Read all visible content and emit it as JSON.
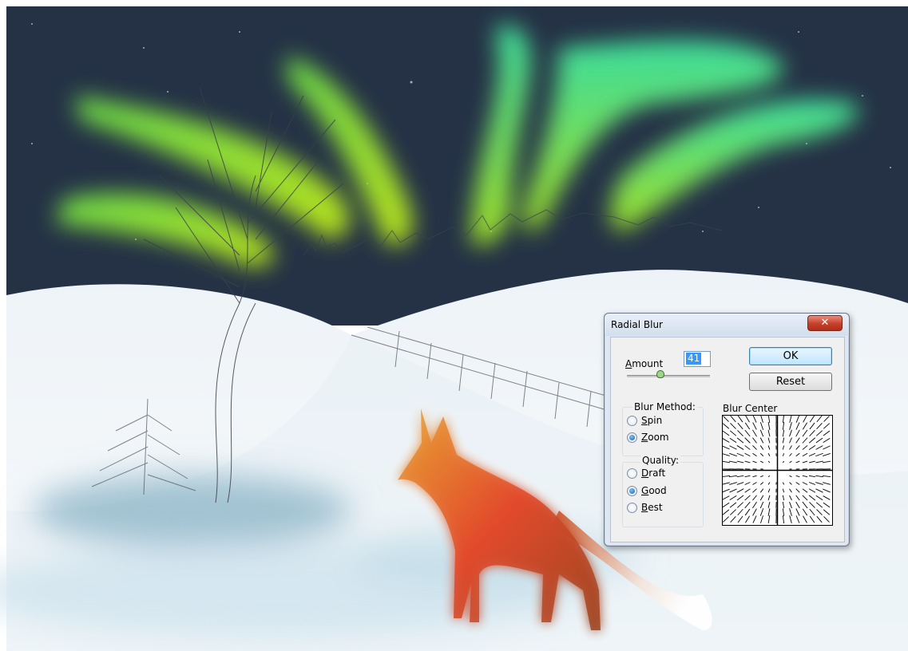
{
  "dialog": {
    "title": "Radial Blur",
    "close_glyph": "✕",
    "amount": {
      "label_first": "A",
      "label_rest": "mount",
      "value": "41",
      "slider_fraction": 0.41
    },
    "buttons": {
      "ok": "OK",
      "reset": "Reset"
    },
    "blur_method": {
      "legend": "Blur Method:",
      "options": [
        {
          "first": "S",
          "rest": "pin",
          "selected": false
        },
        {
          "first": "Z",
          "rest": "oom",
          "selected": true
        }
      ]
    },
    "quality": {
      "legend": "Quality:",
      "options": [
        {
          "first": "D",
          "rest": "raft",
          "selected": false
        },
        {
          "first": "G",
          "rest": "ood",
          "selected": true
        },
        {
          "first": "B",
          "rest": "est",
          "selected": false
        }
      ]
    },
    "blur_center_label": "Blur Center"
  },
  "artwork": {
    "sky_color": "#263346",
    "snow_color": "#e6eff5",
    "aurora_colors": [
      "#6ee04a",
      "#b8e820",
      "#3ee8a0"
    ],
    "fox_colors": [
      "#e8a030",
      "#e0502a",
      "#b04a20"
    ]
  }
}
